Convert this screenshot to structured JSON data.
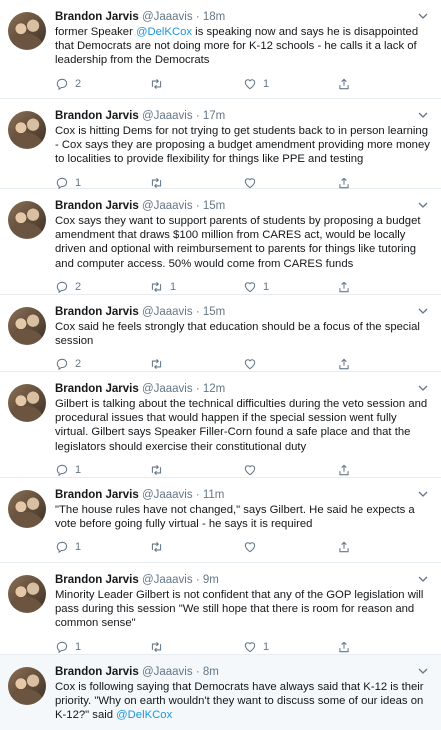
{
  "tweets": [
    {
      "name": "Brandon Jarvis",
      "handle": "@Jaaavis",
      "dot": "·",
      "time": "18m",
      "text_parts": [
        "former Speaker ",
        "@DelKCox",
        " is speaking now and says he is disappointed that Democrats are not doing more for K-12 schools - he calls it a lack of leadership from the Democrats"
      ],
      "replies": "2",
      "retweets": "",
      "likes": "1"
    },
    {
      "name": "Brandon Jarvis",
      "handle": "@Jaaavis",
      "dot": "·",
      "time": "17m",
      "text": "Cox is hitting Dems for not trying to get students back to in person learning - Cox says they are proposing a budget amendment providing more money to localities to provide flexibility for things like PPE and testing",
      "replies": "1",
      "retweets": "",
      "likes": ""
    },
    {
      "name": "Brandon Jarvis",
      "handle": "@Jaaavis",
      "dot": "·",
      "time": "15m",
      "text": "Cox says they want to support parents of students by proposing a budget amendment that draws $100 million from CARES act, would be locally driven and optional with reimbursement to parents for things like tutoring and computer access. 50% would come from CARES funds",
      "replies": "2",
      "retweets": "1",
      "likes": "1"
    },
    {
      "name": "Brandon Jarvis",
      "handle": "@Jaaavis",
      "dot": "·",
      "time": "15m",
      "text": "Cox said he feels strongly that education should be a focus of the special session",
      "replies": "2",
      "retweets": "",
      "likes": ""
    },
    {
      "name": "Brandon Jarvis",
      "handle": "@Jaaavis",
      "dot": "·",
      "time": "12m",
      "text": "Gilbert is talking about the technical difficulties during the veto session and procedural issues that would happen if the special session went fully virtual. Gilbert says Speaker Filler-Corn found a safe place and that the legislators should exercise their constitutional duty",
      "replies": "1",
      "retweets": "",
      "likes": ""
    },
    {
      "name": "Brandon Jarvis",
      "handle": "@Jaaavis",
      "dot": "·",
      "time": "11m",
      "text": "\"The house rules have not changed,\" says Gilbert. He said he expects a vote before going fully virtual - he says it is required",
      "replies": "1",
      "retweets": "",
      "likes": ""
    },
    {
      "name": "Brandon Jarvis",
      "handle": "@Jaaavis",
      "dot": "·",
      "time": "9m",
      "text": "Minority Leader Gilbert is not confident that any of the GOP legislation will pass during this session \"We still hope that there is room for reason and common sense\"",
      "replies": "1",
      "retweets": "",
      "likes": "1"
    },
    {
      "name": "Brandon Jarvis",
      "handle": "@Jaaavis",
      "dot": "·",
      "time": "8m",
      "text_parts": [
        "Cox is following saying that Democrats have always said that K-12 is their priority. \"Why on earth wouldn't they want to discuss some of our ideas on K-12?\" said ",
        "@DelKCox",
        ""
      ]
    }
  ],
  "colors": {
    "accent": "#1b95e0",
    "muted": "#657786",
    "divider": "#e6ecf0"
  },
  "icons": [
    "reply-icon",
    "retweet-icon",
    "like-icon",
    "share-icon",
    "chevron-down-icon"
  ]
}
